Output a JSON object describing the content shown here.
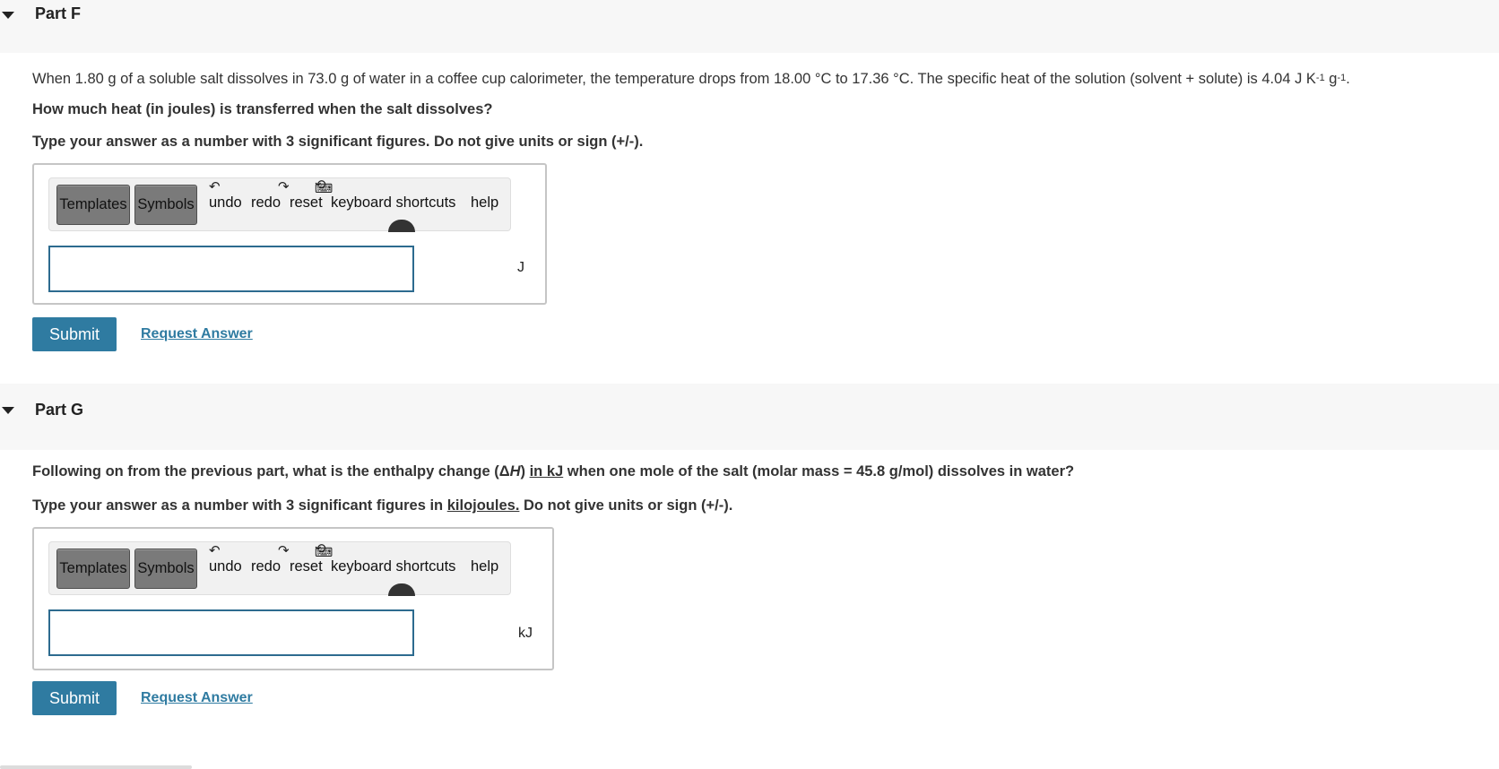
{
  "part_f": {
    "title": "Part F",
    "question_intro": "When 1.80 g of a soluble salt dissolves in 73.0 g of water in a coffee cup calorimeter, the temperature drops from 18.00 °C to 17.36 °C. The specific heat of the solution (solvent + solute) is 4.04 J K",
    "sup1": "-1",
    "middle": " g",
    "sup2": "-1",
    "end": ".",
    "question": "How much heat (in joules) is transferred when the salt dissolves?",
    "instruction": "Type your answer as a number with 3 significant figures.  Do not give units or sign (+/-).",
    "answer_value": "",
    "unit": "J",
    "submit_label": "Submit",
    "request_label": "Request Answer"
  },
  "part_g": {
    "title": "Part G",
    "q_a": "Following on from the previous part, what is the enthalpy change (Δ",
    "q_h": "H",
    "q_b": ") ",
    "q_link": "in kJ",
    "q_c": " when one mole of the salt (molar mass = 45.8 g/mol) dissolves in water?",
    "inst_a": "Type your answer as a number with 3 significant figures in ",
    "inst_link": "kilojoules.",
    "inst_b": "  Do not give units or sign (+/-).",
    "answer_value": "",
    "unit": "kJ",
    "submit_label": "Submit",
    "request_label": "Request Answer"
  },
  "toolbar": {
    "templates_label": "Templates",
    "symbols_label": "Symbols",
    "undo_label": "undo",
    "redo_label": "redo",
    "reset_label": "reset",
    "shortcuts_label": "keyboard shortcuts",
    "help_label": "help"
  },
  "icons": [
    "caret-down-icon",
    "undo-icon",
    "redo-icon",
    "reset-icon",
    "keyboard-icon"
  ],
  "colors": {
    "header_bg": "#f7f7f7",
    "accent": "#2f7ba1",
    "input_border": "#2d6b8f",
    "toolbar_button": "#7a7a7a"
  }
}
